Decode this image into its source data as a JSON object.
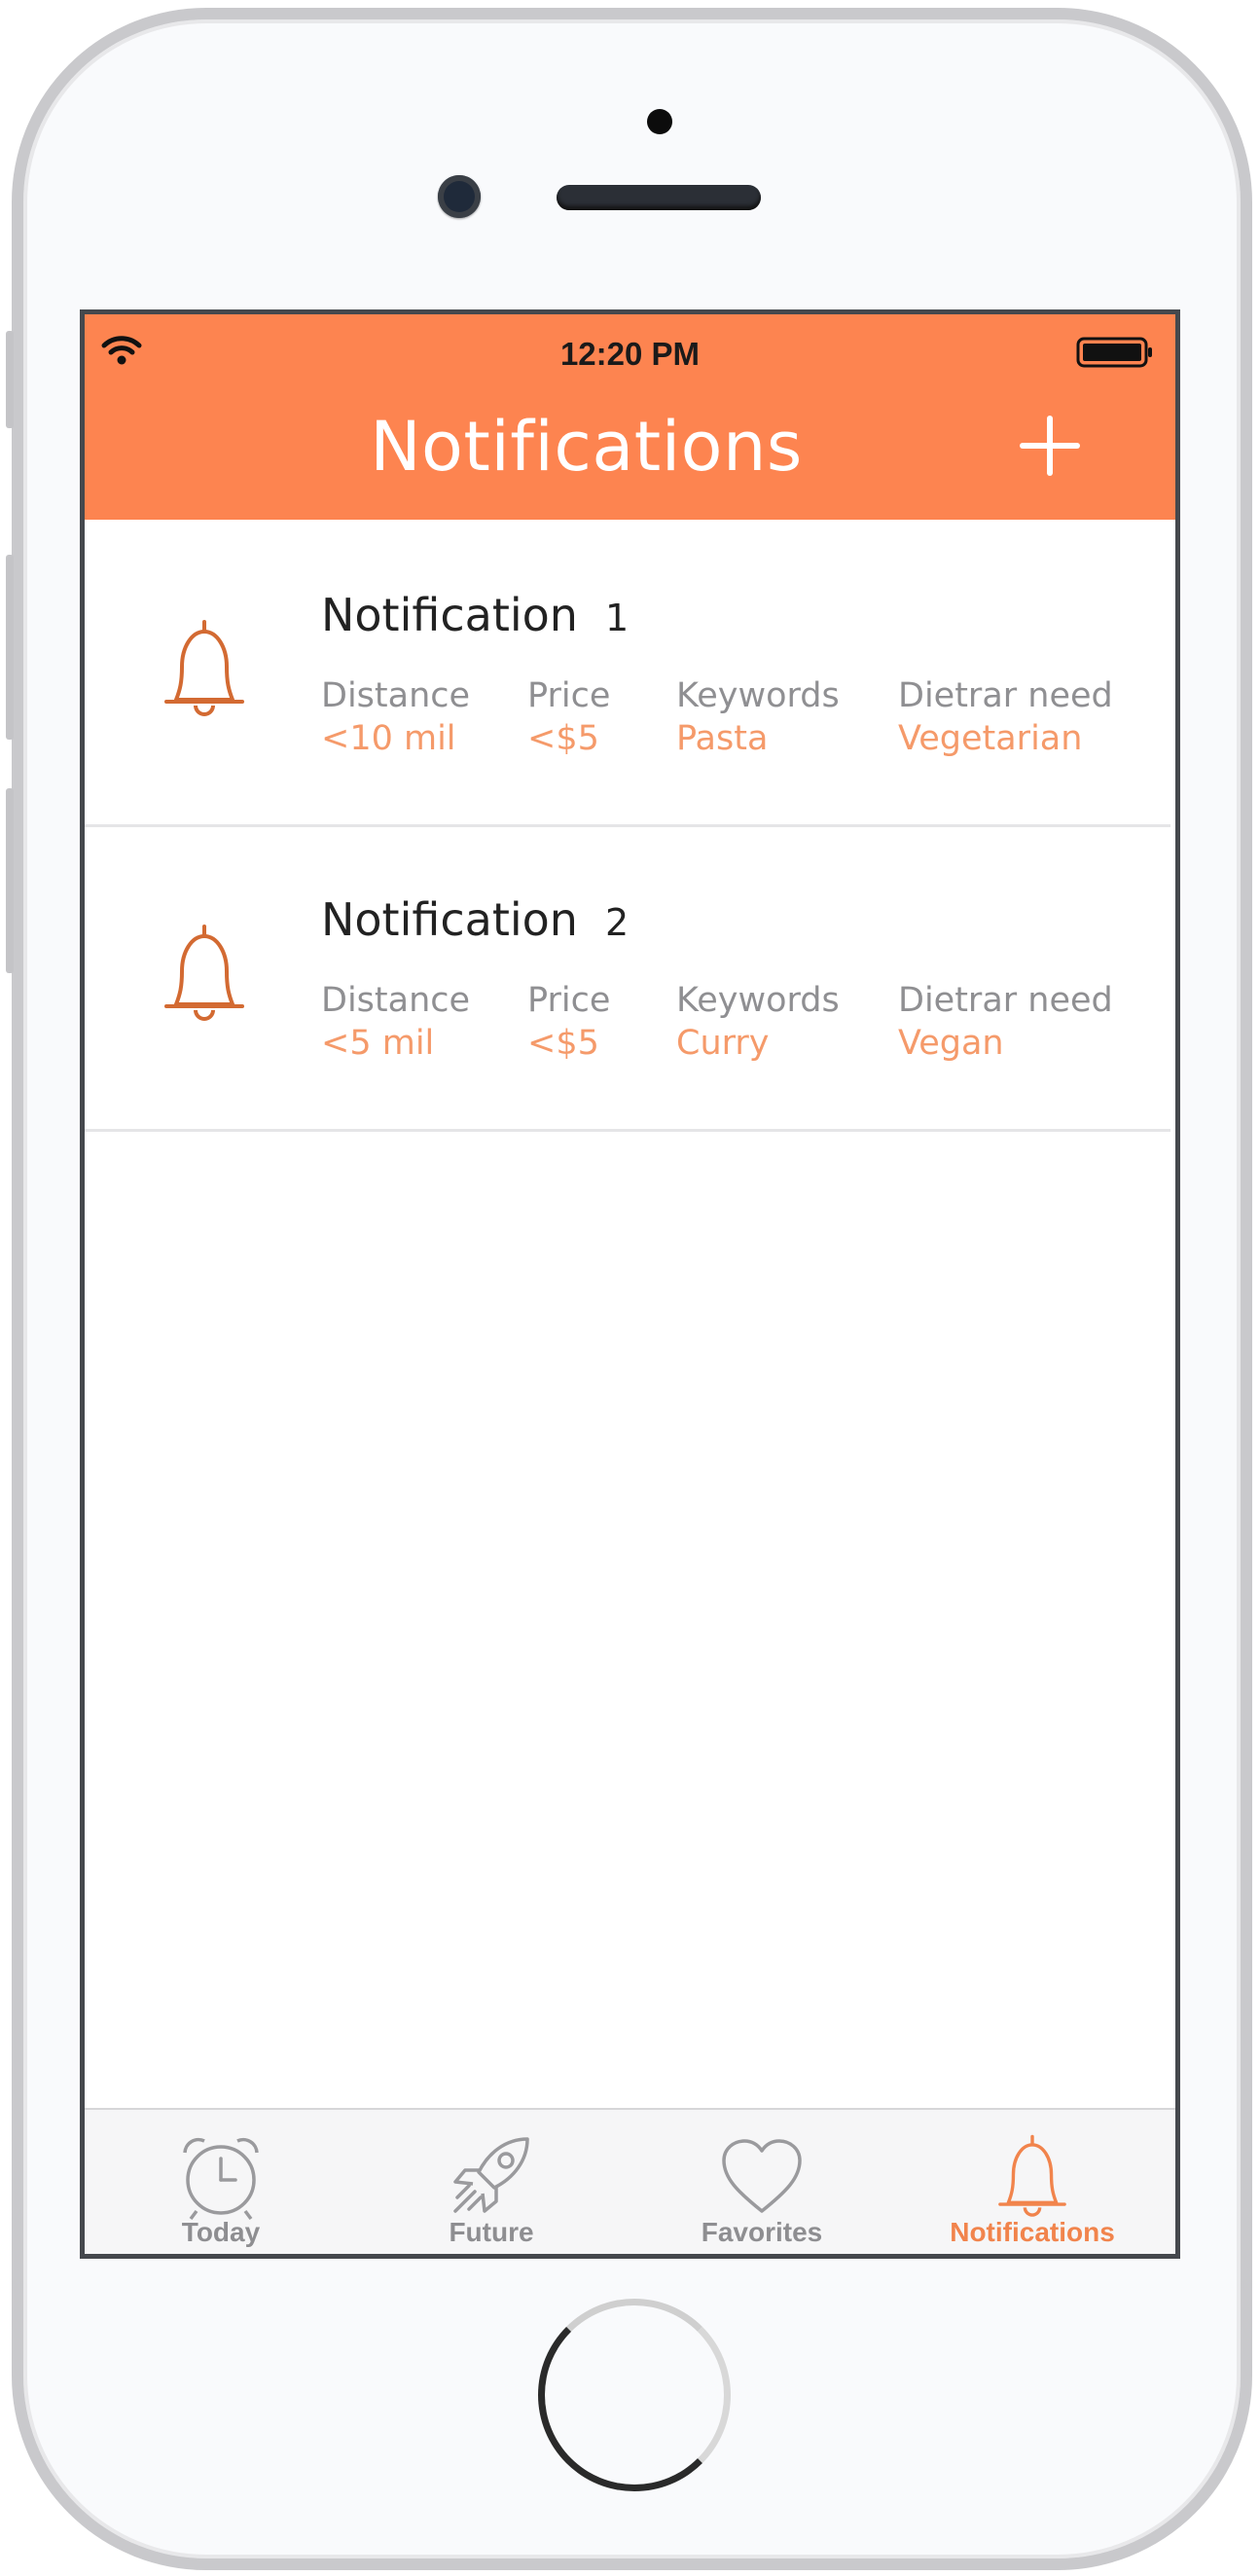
{
  "status_bar": {
    "time": "12:20 PM"
  },
  "header": {
    "title": "Notifications",
    "add_button_label": "+"
  },
  "notifications": [
    {
      "name": "Notification",
      "number": "1",
      "fields": [
        {
          "label": "Distance",
          "value": "<10 mil"
        },
        {
          "label": "Price",
          "value": "<$5"
        },
        {
          "label": "Keywords",
          "value": "Pasta"
        },
        {
          "label": "Dietrar need",
          "value": "Vegetarian"
        }
      ]
    },
    {
      "name": "Notification",
      "number": "2",
      "fields": [
        {
          "label": "Distance",
          "value": "<5 mil"
        },
        {
          "label": "Price",
          "value": "<$5"
        },
        {
          "label": "Keywords",
          "value": "Curry"
        },
        {
          "label": "Dietrar need",
          "value": "Vegan"
        }
      ]
    }
  ],
  "tabbar": {
    "tabs": [
      {
        "label": "Today",
        "icon": "alarm-clock-icon"
      },
      {
        "label": "Future",
        "icon": "rocket-icon"
      },
      {
        "label": "Favorites",
        "icon": "heart-icon"
      },
      {
        "label": "Notifications",
        "icon": "bell-icon"
      }
    ],
    "active_index": 3
  },
  "colors": {
    "accent": "#fd8450",
    "value_text": "#f59a6a",
    "bell": "#d36a32"
  }
}
